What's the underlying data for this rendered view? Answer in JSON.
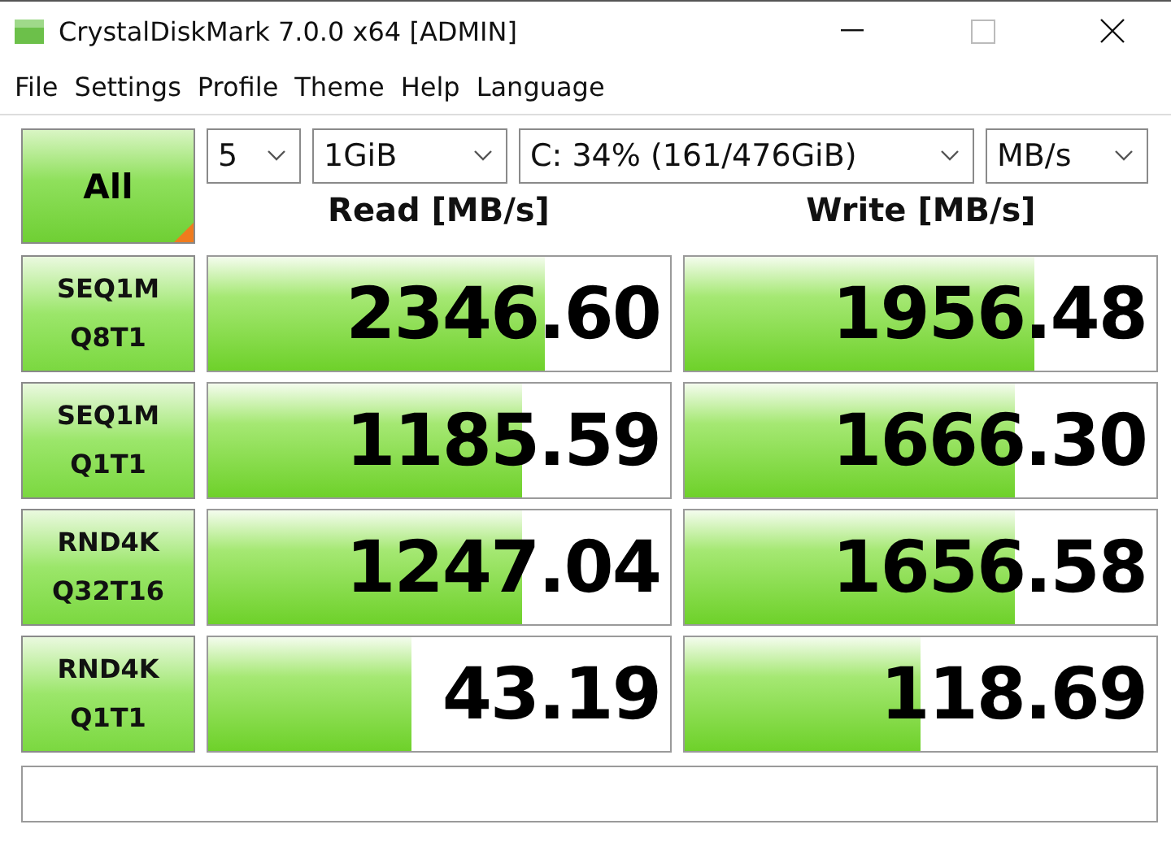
{
  "window": {
    "title": "CrystalDiskMark 7.0.0 x64 [ADMIN]"
  },
  "menu": [
    "File",
    "Settings",
    "Profile",
    "Theme",
    "Help",
    "Language"
  ],
  "all_button": {
    "label": "All"
  },
  "selectors": [
    {
      "value": "5"
    },
    {
      "value": "1GiB"
    },
    {
      "value": "C: 34% (161/476GiB)"
    },
    {
      "value": "MB/s"
    }
  ],
  "columns": [
    "Read [MB/s]",
    "Write [MB/s]"
  ],
  "tests": [
    {
      "line1": "SEQ1M",
      "line2": "Q8T1",
      "read": {
        "reading": "2346.60",
        "level": 0.73
      },
      "write": {
        "reading": "1956.48",
        "level": 0.74
      }
    },
    {
      "line1": "SEQ1M",
      "line2": "Q1T1",
      "read": {
        "reading": "1185.59",
        "level": 0.68
      },
      "write": {
        "reading": "1666.30",
        "level": 0.7
      }
    },
    {
      "line1": "RND4K",
      "line2": "Q32T16",
      "read": {
        "reading": "1247.04",
        "level": 0.68
      },
      "write": {
        "reading": "1656.58",
        "level": 0.7
      }
    },
    {
      "line1": "RND4K",
      "line2": "Q1T1",
      "read": {
        "reading": "43.19",
        "level": 0.44
      },
      "write": {
        "reading": "118.69",
        "level": 0.5
      }
    }
  ]
}
